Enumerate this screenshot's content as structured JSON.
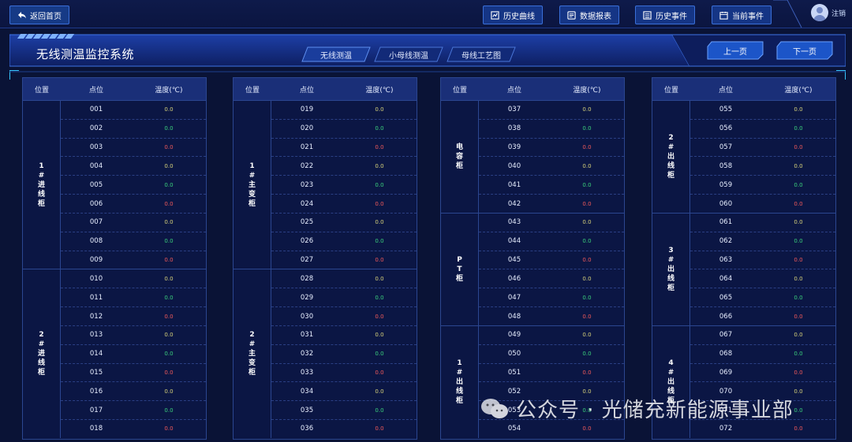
{
  "topbar": {
    "back": "返回首页",
    "nav": [
      {
        "label": "历史曲线",
        "icon": "chart-icon"
      },
      {
        "label": "数据报表",
        "icon": "report-icon"
      },
      {
        "label": "历史事件",
        "icon": "list-icon"
      },
      {
        "label": "当前事件",
        "icon": "calendar-icon"
      }
    ],
    "logout": "注销"
  },
  "header": {
    "title": "无线测温监控系统",
    "tabs": [
      "无线测温",
      "小母线测温",
      "母线工艺图"
    ],
    "prev": "上一页",
    "next": "下一页"
  },
  "table_headers": {
    "position": "位置",
    "point": "点位",
    "temp": "温度(℃)"
  },
  "colors": {
    "yellow": "#d6d27a",
    "green": "#3bd17c",
    "red": "#f05a5a",
    "panel_head": "#1a2f78"
  },
  "panels": [
    {
      "groups": [
        {
          "name": "1#进线柜",
          "rows": [
            [
              "001",
              "0.0",
              "y"
            ],
            [
              "002",
              "0.0",
              "g"
            ],
            [
              "003",
              "0.0",
              "r"
            ],
            [
              "004",
              "0.0",
              "y"
            ],
            [
              "005",
              "0.0",
              "g"
            ],
            [
              "006",
              "0.0",
              "r"
            ],
            [
              "007",
              "0.0",
              "y"
            ],
            [
              "008",
              "0.0",
              "g"
            ],
            [
              "009",
              "0.0",
              "r"
            ]
          ]
        },
        {
          "name": "2#进线柜",
          "rows": [
            [
              "010",
              "0.0",
              "y"
            ],
            [
              "011",
              "0.0",
              "g"
            ],
            [
              "012",
              "0.0",
              "r"
            ],
            [
              "013",
              "0.0",
              "y"
            ],
            [
              "014",
              "0.0",
              "g"
            ],
            [
              "015",
              "0.0",
              "r"
            ],
            [
              "016",
              "0.0",
              "y"
            ],
            [
              "017",
              "0.0",
              "g"
            ],
            [
              "018",
              "0.0",
              "r"
            ]
          ]
        }
      ]
    },
    {
      "groups": [
        {
          "name": "1#主变柜",
          "rows": [
            [
              "019",
              "0.0",
              "y"
            ],
            [
              "020",
              "0.0",
              "g"
            ],
            [
              "021",
              "0.0",
              "r"
            ],
            [
              "022",
              "0.0",
              "y"
            ],
            [
              "023",
              "0.0",
              "g"
            ],
            [
              "024",
              "0.0",
              "r"
            ],
            [
              "025",
              "0.0",
              "y"
            ],
            [
              "026",
              "0.0",
              "g"
            ],
            [
              "027",
              "0.0",
              "r"
            ]
          ]
        },
        {
          "name": "2#主变柜",
          "rows": [
            [
              "028",
              "0.0",
              "y"
            ],
            [
              "029",
              "0.0",
              "g"
            ],
            [
              "030",
              "0.0",
              "r"
            ],
            [
              "031",
              "0.0",
              "y"
            ],
            [
              "032",
              "0.0",
              "g"
            ],
            [
              "033",
              "0.0",
              "r"
            ],
            [
              "034",
              "0.0",
              "y"
            ],
            [
              "035",
              "0.0",
              "g"
            ],
            [
              "036",
              "0.0",
              "r"
            ]
          ]
        }
      ]
    },
    {
      "groups": [
        {
          "name": "电容柜",
          "rows": [
            [
              "037",
              "0.0",
              "y"
            ],
            [
              "038",
              "0.0",
              "g"
            ],
            [
              "039",
              "0.0",
              "r"
            ],
            [
              "040",
              "0.0",
              "y"
            ],
            [
              "041",
              "0.0",
              "g"
            ],
            [
              "042",
              "0.0",
              "r"
            ]
          ]
        },
        {
          "name": "PT柜",
          "rows": [
            [
              "043",
              "0.0",
              "y"
            ],
            [
              "044",
              "0.0",
              "g"
            ],
            [
              "045",
              "0.0",
              "r"
            ],
            [
              "046",
              "0.0",
              "y"
            ],
            [
              "047",
              "0.0",
              "g"
            ],
            [
              "048",
              "0.0",
              "r"
            ]
          ]
        },
        {
          "name": "1#出线柜",
          "rows": [
            [
              "049",
              "0.0",
              "y"
            ],
            [
              "050",
              "0.0",
              "g"
            ],
            [
              "051",
              "0.0",
              "r"
            ],
            [
              "052",
              "0.0",
              "y"
            ],
            [
              "053",
              "0.0",
              "g"
            ],
            [
              "054",
              "0.0",
              "r"
            ]
          ]
        }
      ]
    },
    {
      "groups": [
        {
          "name": "2#出线柜",
          "rows": [
            [
              "055",
              "0.0",
              "y"
            ],
            [
              "056",
              "0.0",
              "g"
            ],
            [
              "057",
              "0.0",
              "r"
            ],
            [
              "058",
              "0.0",
              "y"
            ],
            [
              "059",
              "0.0",
              "g"
            ],
            [
              "060",
              "0.0",
              "r"
            ]
          ]
        },
        {
          "name": "3#出线柜",
          "rows": [
            [
              "061",
              "0.0",
              "y"
            ],
            [
              "062",
              "0.0",
              "g"
            ],
            [
              "063",
              "0.0",
              "r"
            ],
            [
              "064",
              "0.0",
              "y"
            ],
            [
              "065",
              "0.0",
              "g"
            ],
            [
              "066",
              "0.0",
              "r"
            ]
          ]
        },
        {
          "name": "4#出线柜",
          "rows": [
            [
              "067",
              "0.0",
              "y"
            ],
            [
              "068",
              "0.0",
              "g"
            ],
            [
              "069",
              "0.0",
              "r"
            ],
            [
              "070",
              "0.0",
              "y"
            ],
            [
              "071",
              "0.0",
              "g"
            ],
            [
              "072",
              "0.0",
              "r"
            ]
          ]
        }
      ]
    }
  ],
  "watermark": "公众号 · 光储充新能源事业部"
}
